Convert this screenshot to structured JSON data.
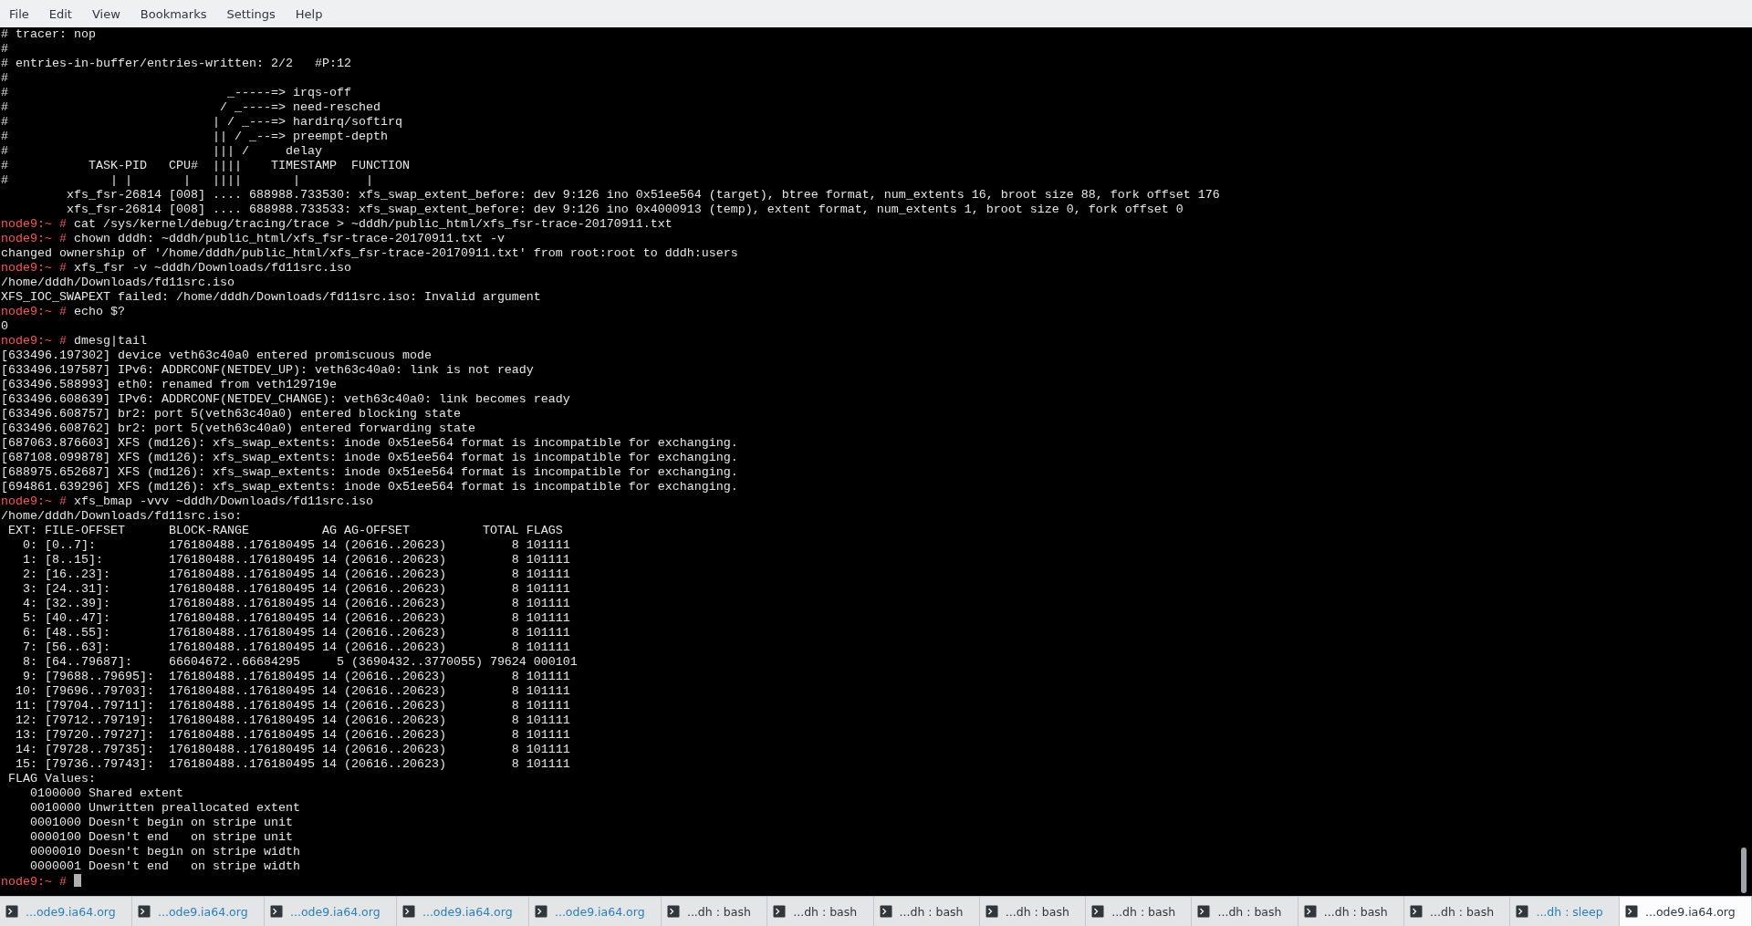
{
  "menu_bar": {
    "items": [
      "File",
      "Edit",
      "View",
      "Bookmarks",
      "Settings",
      "Help"
    ]
  },
  "terminal": {
    "lines": [
      {
        "kind": "output",
        "text": "# tracer: nop"
      },
      {
        "kind": "output",
        "text": "#"
      },
      {
        "kind": "output",
        "text": "# entries-in-buffer/entries-written: 2/2   #P:12"
      },
      {
        "kind": "output",
        "text": "#"
      },
      {
        "kind": "output",
        "text": "#                              _-----=> irqs-off"
      },
      {
        "kind": "output",
        "text": "#                             / _----=> need-resched"
      },
      {
        "kind": "output",
        "text": "#                            | / _---=> hardirq/softirq"
      },
      {
        "kind": "output",
        "text": "#                            || / _--=> preempt-depth"
      },
      {
        "kind": "output",
        "text": "#                            ||| /     delay"
      },
      {
        "kind": "output",
        "text": "#           TASK-PID   CPU#  ||||    TIMESTAMP  FUNCTION"
      },
      {
        "kind": "output",
        "text": "#              | |       |   ||||       |         |"
      },
      {
        "kind": "output",
        "text": "         xfs_fsr-26814 [008] .... 688988.733530: xfs_swap_extent_before: dev 9:126 ino 0x51ee564 (target), btree format, num_extents 16, broot size 88, fork offset 176"
      },
      {
        "kind": "output",
        "text": "         xfs_fsr-26814 [008] .... 688988.733533: xfs_swap_extent_before: dev 9:126 ino 0x4000913 (temp), extent format, num_extents 1, broot size 0, fork offset 0"
      },
      {
        "kind": "prompt",
        "prompt": "node9:~ #",
        "command": "cat /sys/kernel/debug/tracing/trace > ~dddh/public_html/xfs_fsr-trace-20170911.txt"
      },
      {
        "kind": "prompt",
        "prompt": "node9:~ #",
        "command": "chown dddh: ~dddh/public_html/xfs_fsr-trace-20170911.txt -v"
      },
      {
        "kind": "output",
        "text": "changed ownership of '/home/dddh/public_html/xfs_fsr-trace-20170911.txt' from root:root to dddh:users"
      },
      {
        "kind": "prompt",
        "prompt": "node9:~ #",
        "command": "xfs_fsr -v ~dddh/Downloads/fd11src.iso"
      },
      {
        "kind": "output",
        "text": "/home/dddh/Downloads/fd11src.iso"
      },
      {
        "kind": "output",
        "text": "XFS_IOC_SWAPEXT failed: /home/dddh/Downloads/fd11src.iso: Invalid argument"
      },
      {
        "kind": "prompt",
        "prompt": "node9:~ #",
        "command": "echo $?"
      },
      {
        "kind": "output",
        "text": "0"
      },
      {
        "kind": "prompt",
        "prompt": "node9:~ #",
        "command": "dmesg|tail"
      },
      {
        "kind": "output",
        "text": "[633496.197302] device veth63c40a0 entered promiscuous mode"
      },
      {
        "kind": "output",
        "text": "[633496.197587] IPv6: ADDRCONF(NETDEV_UP): veth63c40a0: link is not ready"
      },
      {
        "kind": "output",
        "text": "[633496.588993] eth0: renamed from veth129719e"
      },
      {
        "kind": "output",
        "text": "[633496.608639] IPv6: ADDRCONF(NETDEV_CHANGE): veth63c40a0: link becomes ready"
      },
      {
        "kind": "output",
        "text": "[633496.608757] br2: port 5(veth63c40a0) entered blocking state"
      },
      {
        "kind": "output",
        "text": "[633496.608762] br2: port 5(veth63c40a0) entered forwarding state"
      },
      {
        "kind": "output",
        "text": "[687063.876603] XFS (md126): xfs_swap_extents: inode 0x51ee564 format is incompatible for exchanging."
      },
      {
        "kind": "output",
        "text": "[687108.099878] XFS (md126): xfs_swap_extents: inode 0x51ee564 format is incompatible for exchanging."
      },
      {
        "kind": "output",
        "text": "[688975.652687] XFS (md126): xfs_swap_extents: inode 0x51ee564 format is incompatible for exchanging."
      },
      {
        "kind": "output",
        "text": "[694861.639296] XFS (md126): xfs_swap_extents: inode 0x51ee564 format is incompatible for exchanging."
      },
      {
        "kind": "prompt",
        "prompt": "node9:~ #",
        "command": "xfs_bmap -vvv ~dddh/Downloads/fd11src.iso"
      },
      {
        "kind": "output",
        "text": "/home/dddh/Downloads/fd11src.iso:"
      },
      {
        "kind": "output",
        "text": " EXT: FILE-OFFSET      BLOCK-RANGE          AG AG-OFFSET          TOTAL FLAGS"
      },
      {
        "kind": "output",
        "text": "   0: [0..7]:          176180488..176180495 14 (20616..20623)         8 101111"
      },
      {
        "kind": "output",
        "text": "   1: [8..15]:         176180488..176180495 14 (20616..20623)         8 101111"
      },
      {
        "kind": "output",
        "text": "   2: [16..23]:        176180488..176180495 14 (20616..20623)         8 101111"
      },
      {
        "kind": "output",
        "text": "   3: [24..31]:        176180488..176180495 14 (20616..20623)         8 101111"
      },
      {
        "kind": "output",
        "text": "   4: [32..39]:        176180488..176180495 14 (20616..20623)         8 101111"
      },
      {
        "kind": "output",
        "text": "   5: [40..47]:        176180488..176180495 14 (20616..20623)         8 101111"
      },
      {
        "kind": "output",
        "text": "   6: [48..55]:        176180488..176180495 14 (20616..20623)         8 101111"
      },
      {
        "kind": "output",
        "text": "   7: [56..63]:        176180488..176180495 14 (20616..20623)         8 101111"
      },
      {
        "kind": "output",
        "text": "   8: [64..79687]:     66604672..66684295     5 (3690432..3770055) 79624 000101"
      },
      {
        "kind": "output",
        "text": "   9: [79688..79695]:  176180488..176180495 14 (20616..20623)         8 101111"
      },
      {
        "kind": "output",
        "text": "  10: [79696..79703]:  176180488..176180495 14 (20616..20623)         8 101111"
      },
      {
        "kind": "output",
        "text": "  11: [79704..79711]:  176180488..176180495 14 (20616..20623)         8 101111"
      },
      {
        "kind": "output",
        "text": "  12: [79712..79719]:  176180488..176180495 14 (20616..20623)         8 101111"
      },
      {
        "kind": "output",
        "text": "  13: [79720..79727]:  176180488..176180495 14 (20616..20623)         8 101111"
      },
      {
        "kind": "output",
        "text": "  14: [79728..79735]:  176180488..176180495 14 (20616..20623)         8 101111"
      },
      {
        "kind": "output",
        "text": "  15: [79736..79743]:  176180488..176180495 14 (20616..20623)         8 101111"
      },
      {
        "kind": "output",
        "text": " FLAG Values:"
      },
      {
        "kind": "output",
        "text": "    0100000 Shared extent"
      },
      {
        "kind": "output",
        "text": "    0010000 Unwritten preallocated extent"
      },
      {
        "kind": "output",
        "text": "    0001000 Doesn't begin on stripe unit"
      },
      {
        "kind": "output",
        "text": "    0000100 Doesn't end   on stripe unit"
      },
      {
        "kind": "output",
        "text": "    0000010 Doesn't begin on stripe width"
      },
      {
        "kind": "output",
        "text": "    0000001 Doesn't end   on stripe width"
      },
      {
        "kind": "cursor_prompt",
        "prompt": "node9:~ #"
      }
    ]
  },
  "tabs": [
    {
      "label": "...ode9.ia64.org",
      "activity": true,
      "selected": false
    },
    {
      "label": "...ode9.ia64.org",
      "activity": true,
      "selected": false
    },
    {
      "label": "...ode9.ia64.org",
      "activity": true,
      "selected": false
    },
    {
      "label": "...ode9.ia64.org",
      "activity": true,
      "selected": false
    },
    {
      "label": "...ode9.ia64.org",
      "activity": true,
      "selected": false
    },
    {
      "label": "...dh : bash",
      "activity": false,
      "selected": false
    },
    {
      "label": "...dh : bash",
      "activity": false,
      "selected": false
    },
    {
      "label": "...dh : bash",
      "activity": false,
      "selected": false
    },
    {
      "label": "...dh : bash",
      "activity": false,
      "selected": false
    },
    {
      "label": "...dh : bash",
      "activity": false,
      "selected": false
    },
    {
      "label": "...dh : bash",
      "activity": false,
      "selected": false
    },
    {
      "label": "...dh : bash",
      "activity": false,
      "selected": false
    },
    {
      "label": "...dh : bash",
      "activity": false,
      "selected": false
    },
    {
      "label": "...dh : sleep",
      "activity": true,
      "selected": false
    },
    {
      "label": "...ode9.ia64.org",
      "activity": false,
      "selected": true
    }
  ]
}
